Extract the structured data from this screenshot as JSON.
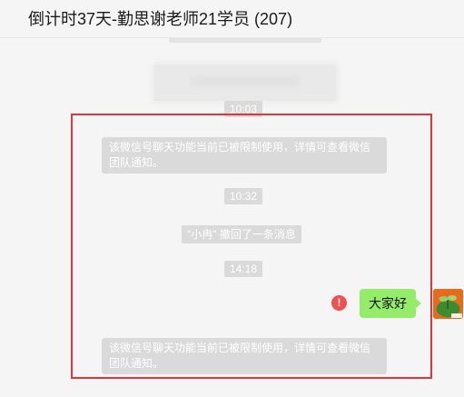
{
  "window": {
    "title": "倒计时37天-勤思谢老师21学员 (207)"
  },
  "chat": {
    "time_1": "10:03",
    "system_notice_1": "该微信号聊天功能当前已被限制使用，详情可查看微信团队通知。",
    "time_2": "10:32",
    "recall_notice": "\"小冉\" 撤回了一条消息",
    "time_3": "14:18",
    "sent_message": "大家好",
    "send_failed_symbol": "!",
    "system_notice_2": "该微信号聊天功能当前已被限制使用，详情可查看微信团队通知。"
  },
  "colors": {
    "highlight_border": "#e0363b",
    "sent_bubble": "#95ec69",
    "error_icon": "#f0504f",
    "system_pill": "#dadada"
  },
  "icons": {
    "send_failed": "exclamation-circle-icon",
    "avatar": "sprout-avatar"
  }
}
